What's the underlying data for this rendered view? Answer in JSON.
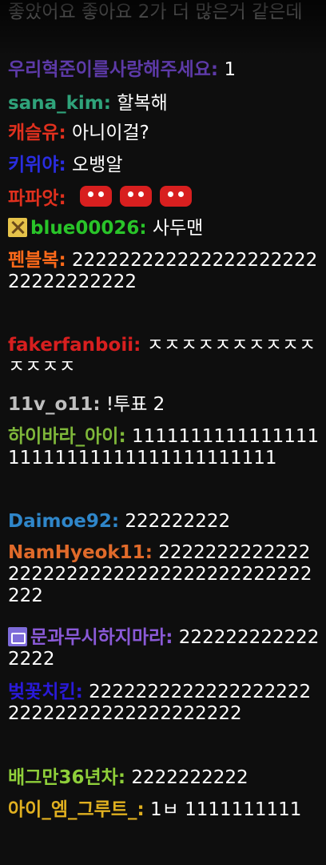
{
  "chat": {
    "messages": [
      {
        "name": "",
        "name_color": "#9a9a9a",
        "text": "좋았어요 좋아요 2가 더 많은거 같은데"
      },
      {
        "name": "우리혁준이를사랑해주세요",
        "name_color": "#5d3aa8",
        "text": "1"
      },
      {
        "name": "sana_kim",
        "name_color": "#2fa37a",
        "text": "할복해"
      },
      {
        "name": "캐슬유",
        "name_color": "#e0301e",
        "text": "아니이걸?"
      },
      {
        "name": "키위야",
        "name_color": "#2a2de0",
        "text": "오뱅알"
      },
      {
        "name": "파파앗",
        "name_color": "#e0301e",
        "text": "",
        "emotes": [
          "red-blob-emote",
          "red-blob-emote",
          "red-blob-emote"
        ]
      },
      {
        "name": "blue00026",
        "name_color": "#29c429",
        "badge": "tools-badge-icon",
        "text": "사두맨"
      },
      {
        "name": "펜블복",
        "name_color": "#ff6a1a",
        "text": "22222222222222222222222222222222"
      },
      {
        "name": "fakerfanboii",
        "name_color": "#d81f1f",
        "text": "ㅈㅈㅈㅈㅈㅈㅈㅈㅈㅈㅈㅈㅈㅈ"
      },
      {
        "name": "11v_o11",
        "name_color": "#bfbfbf",
        "text": "!투표 2"
      },
      {
        "name": "하이바라_아이",
        "name_color": "#7fb83a",
        "text": "111111111111111111111111111111111111111"
      },
      {
        "name": "Daimoe92",
        "name_color": "#2f86c9",
        "text": "222222222"
      },
      {
        "name": "NamHyeok11",
        "name_color": "#e06a2a",
        "text": "222222222222222222222222222222222222222222"
      },
      {
        "name": "문과무시하지마라",
        "name_color": "#8a5ad8",
        "badge": "battery-badge-icon",
        "text": "2222222222222222"
      },
      {
        "name": "벚꽃치킨",
        "name_color": "#2a1ad8",
        "text": "222222222222222222222222222222222222222"
      },
      {
        "name": "배그만36년차",
        "name_color": "#8fcf3a",
        "text": "2222222222"
      },
      {
        "name": "아이_엠_그루트_",
        "name_color": "#e0b020",
        "text": "1ㅂ 1111111111"
      }
    ]
  }
}
